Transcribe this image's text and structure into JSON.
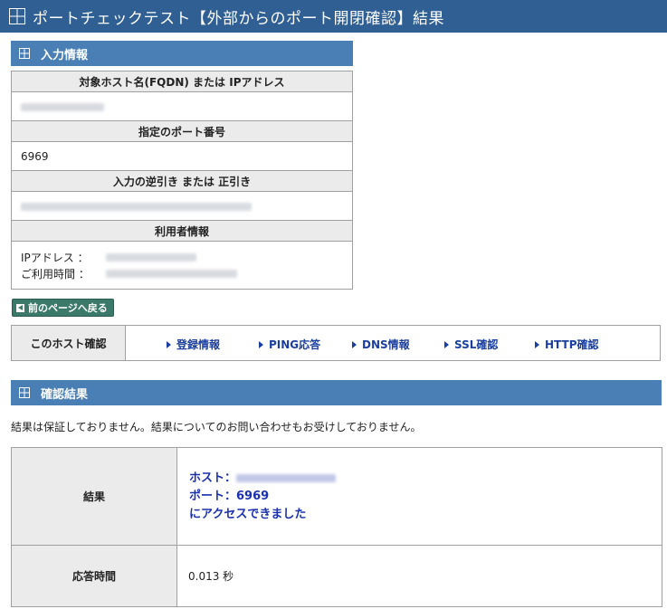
{
  "header": {
    "title": "ポートチェックテスト【外部からのポート開閉確認】結果"
  },
  "input_section": {
    "title": "入力情報",
    "host_label": "対象ホスト名(FQDN) または IPアドレス",
    "port_label": "指定のポート番号",
    "port_value": "6969",
    "reverse_label": "入力の逆引き または 正引き",
    "user_label": "利用者情報",
    "ip_label": "IPアドレス  ：",
    "time_label": "ご利用時間  ："
  },
  "back_button": {
    "label": "前のページへ戻る"
  },
  "host_check": {
    "label": "このホスト確認",
    "links": [
      "登録情報",
      "PING応答",
      "DNS情報",
      "SSL確認",
      "HTTP確認"
    ]
  },
  "result_section": {
    "title": "確認結果",
    "note": "結果は保証しておりません。結果についてのお問い合わせもお受けしておりません。",
    "result_label": "結果",
    "host_prefix": "ホスト：",
    "port_line": "ポート：6969",
    "access_line": "にアクセスできました",
    "response_label": "応答時間",
    "response_value": "0.013 秒"
  }
}
